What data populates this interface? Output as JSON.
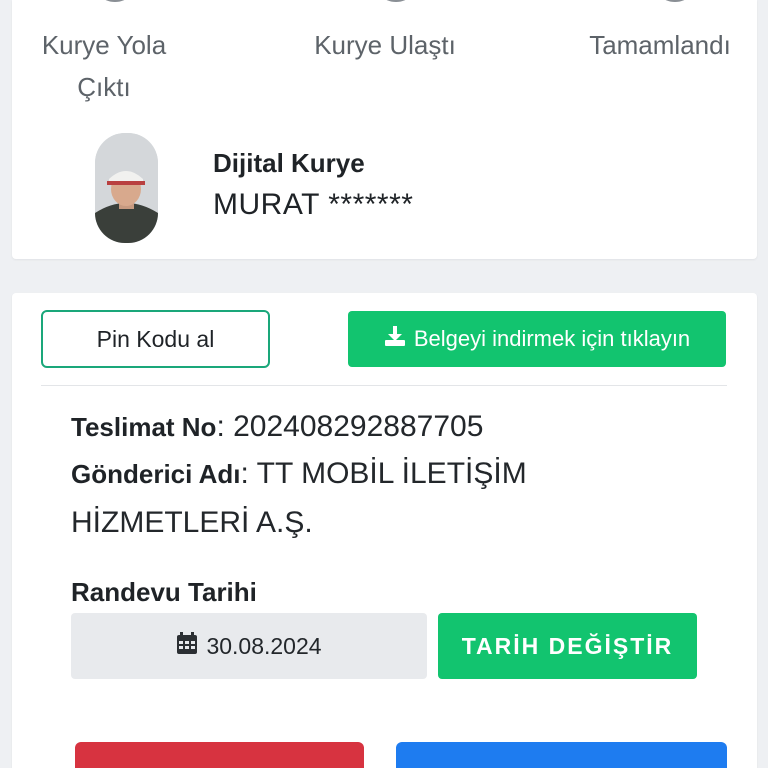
{
  "steps": [
    {
      "label_line1": "Kurye Yola",
      "label_line2": "Çıktı"
    },
    {
      "label_line1": "Kurye Ulaştı",
      "label_line2": ""
    },
    {
      "label_line1": "Tamamlandı",
      "label_line2": ""
    }
  ],
  "courier": {
    "title": "Dijital Kurye",
    "name": "MURAT *******"
  },
  "actions": {
    "pin_label": "Pin Kodu al",
    "download_label": "Belgeyi indirmek için tıklayın",
    "download_icon": "download-icon"
  },
  "delivery": {
    "number_label": "Teslimat No",
    "number_value": "202408292887705",
    "sender_label": "Gönderici Adı",
    "sender_value_line1": "TT MOBİL İLETİŞİM",
    "sender_value_line2": "HİZMETLERİ A.Ş."
  },
  "appointment": {
    "label": "Randevu Tarihi",
    "date": "30.08.2024",
    "date_icon": "calendar-icon",
    "change_label": "TARİH DEĞİŞTİR"
  },
  "colors": {
    "green": "#12c46f",
    "outline_green": "#1aa77a",
    "red": "#d73340",
    "blue": "#1e7cf0"
  }
}
